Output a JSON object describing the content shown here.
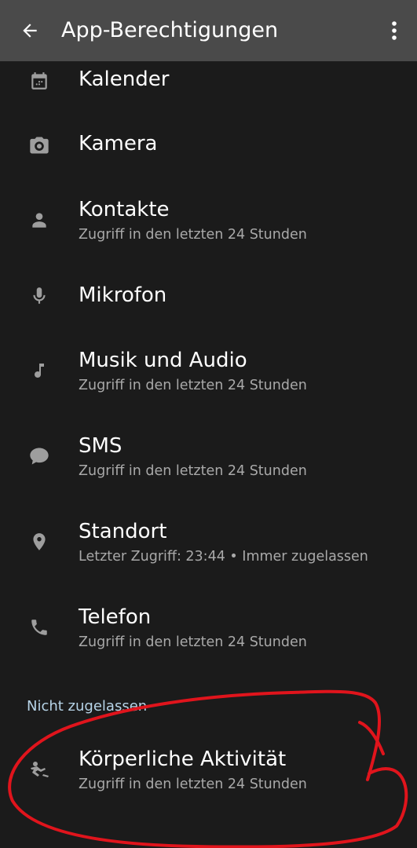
{
  "app_bar": {
    "title": "App-Berechtigungen",
    "back_icon": "arrow-back-icon",
    "menu_icon": "more-vert-icon"
  },
  "allowed_permissions": [
    {
      "title": "Kalender",
      "subtitle": "",
      "icon": "calendar-icon"
    },
    {
      "title": "Kamera",
      "subtitle": "",
      "icon": "camera-icon"
    },
    {
      "title": "Kontakte",
      "subtitle": "Zugriff in den letzten 24 Stunden",
      "icon": "person-icon"
    },
    {
      "title": "Mikrofon",
      "subtitle": "",
      "icon": "microphone-icon"
    },
    {
      "title": "Musik und Audio",
      "subtitle": "Zugriff in den letzten 24 Stunden",
      "icon": "music-note-icon"
    },
    {
      "title": "SMS",
      "subtitle": "Zugriff in den letzten 24 Stunden",
      "icon": "message-icon"
    },
    {
      "title": "Standort",
      "subtitle": "Letzter Zugriff: 23:44 • Immer zugelassen",
      "icon": "location-pin-icon"
    },
    {
      "title": "Telefon",
      "subtitle": "Zugriff in den letzten 24 Stunden",
      "icon": "phone-icon"
    }
  ],
  "denied_section": {
    "header": "Nicht zugelassen",
    "items": [
      {
        "title": "Körperliche Aktivität",
        "subtitle": "Zugriff in den letzten 24 Stunden",
        "icon": "activity-icon"
      }
    ]
  },
  "colors": {
    "background": "#1b1b1b",
    "app_bar": "#4a4a4a",
    "icon": "#9e9e9e",
    "subtitle": "#a9a9a9",
    "section_header": "#b7d4e8",
    "annotation": "#e0141c"
  }
}
